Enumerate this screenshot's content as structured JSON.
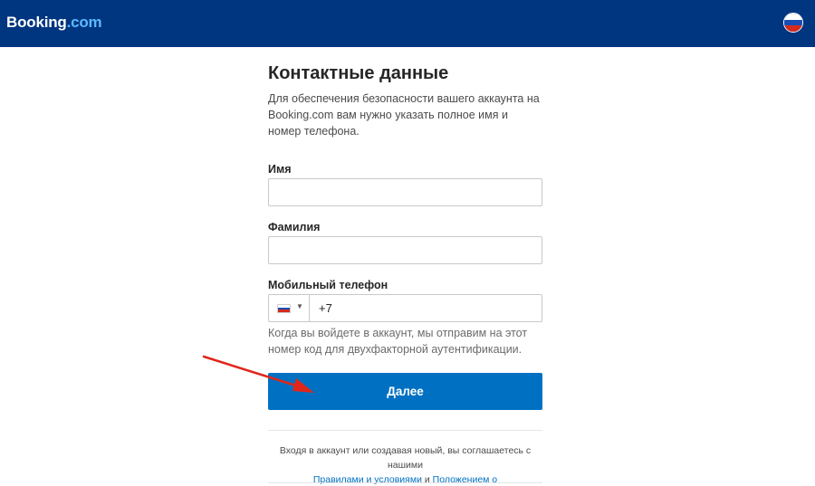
{
  "header": {
    "logo_main": "Booking",
    "logo_suffix": ".com",
    "language_flag": "russia-flag-icon"
  },
  "form": {
    "title": "Контактные данные",
    "intro": "Для обеспечения безопасности вашего аккаунта на Booking.com вам нужно указать полное имя и номер телефона.",
    "first_name_label": "Имя",
    "first_name_value": "",
    "last_name_label": "Фамилия",
    "last_name_value": "",
    "phone_label": "Мобильный телефон",
    "phone_country_flag": "russia-flag-icon",
    "phone_prefix": "+7",
    "phone_hint": "Когда вы войдете в аккаунт, мы отправим на этот номер код для двухфакторной аутентификации.",
    "next_button": "Далее"
  },
  "terms": {
    "text": "Входя в аккаунт или создавая новый, вы соглашаетесь с нашими",
    "link_terms": "Правилами и условиями",
    "conjunction": "и",
    "link_privacy": "Положением о конфиденциальности"
  },
  "colors": {
    "header_bg": "#003580",
    "button_bg": "#0071c2",
    "link": "#0071c2",
    "annotation_arrow": "#e0261b"
  }
}
